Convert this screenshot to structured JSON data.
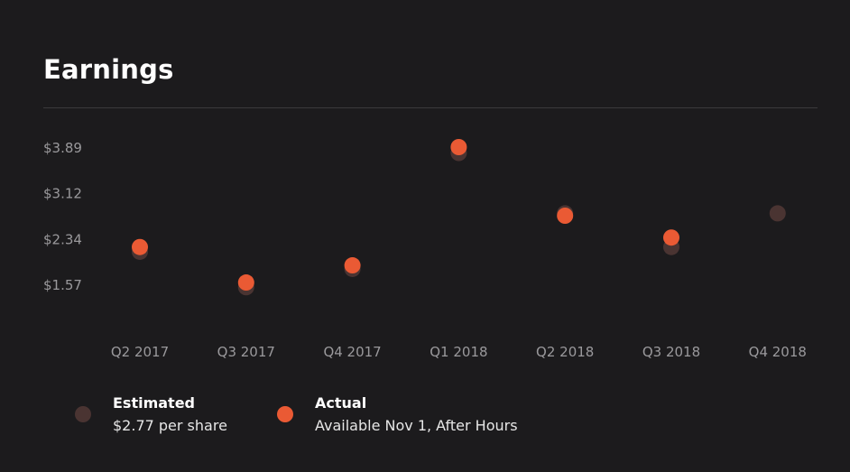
{
  "header": {
    "title": "Earnings"
  },
  "colors": {
    "background": "#1c1b1d",
    "estimated": "#4a3432",
    "actual": "#ea5a34",
    "axis_text": "#9a999c"
  },
  "legend": {
    "estimated": {
      "title": "Estimated",
      "subtitle": "$2.77 per share",
      "icon": "dot-icon"
    },
    "actual": {
      "title": "Actual",
      "subtitle": "Available Nov 1, After Hours",
      "icon": "dot-icon"
    }
  },
  "chart_data": {
    "type": "scatter",
    "title": "",
    "xlabel": "",
    "ylabel": "",
    "categories": [
      "Q2 2017",
      "Q3 2017",
      "Q4 2017",
      "Q1 2018",
      "Q2 2018",
      "Q3 2018",
      "Q4 2018"
    ],
    "y_ticks": [
      1.57,
      2.34,
      3.12,
      3.89
    ],
    "y_tick_labels": [
      "$1.57",
      "$2.34",
      "$3.12",
      "$3.89"
    ],
    "ylim": [
      1.0,
      4.5
    ],
    "grid": false,
    "legend_position": "bottom-left",
    "series": [
      {
        "name": "Estimated",
        "values": [
          2.12,
          1.52,
          1.83,
          3.79,
          2.77,
          2.2,
          2.77
        ]
      },
      {
        "name": "Actual",
        "values": [
          2.2,
          1.6,
          1.89,
          3.89,
          2.73,
          2.36,
          null
        ]
      }
    ]
  }
}
